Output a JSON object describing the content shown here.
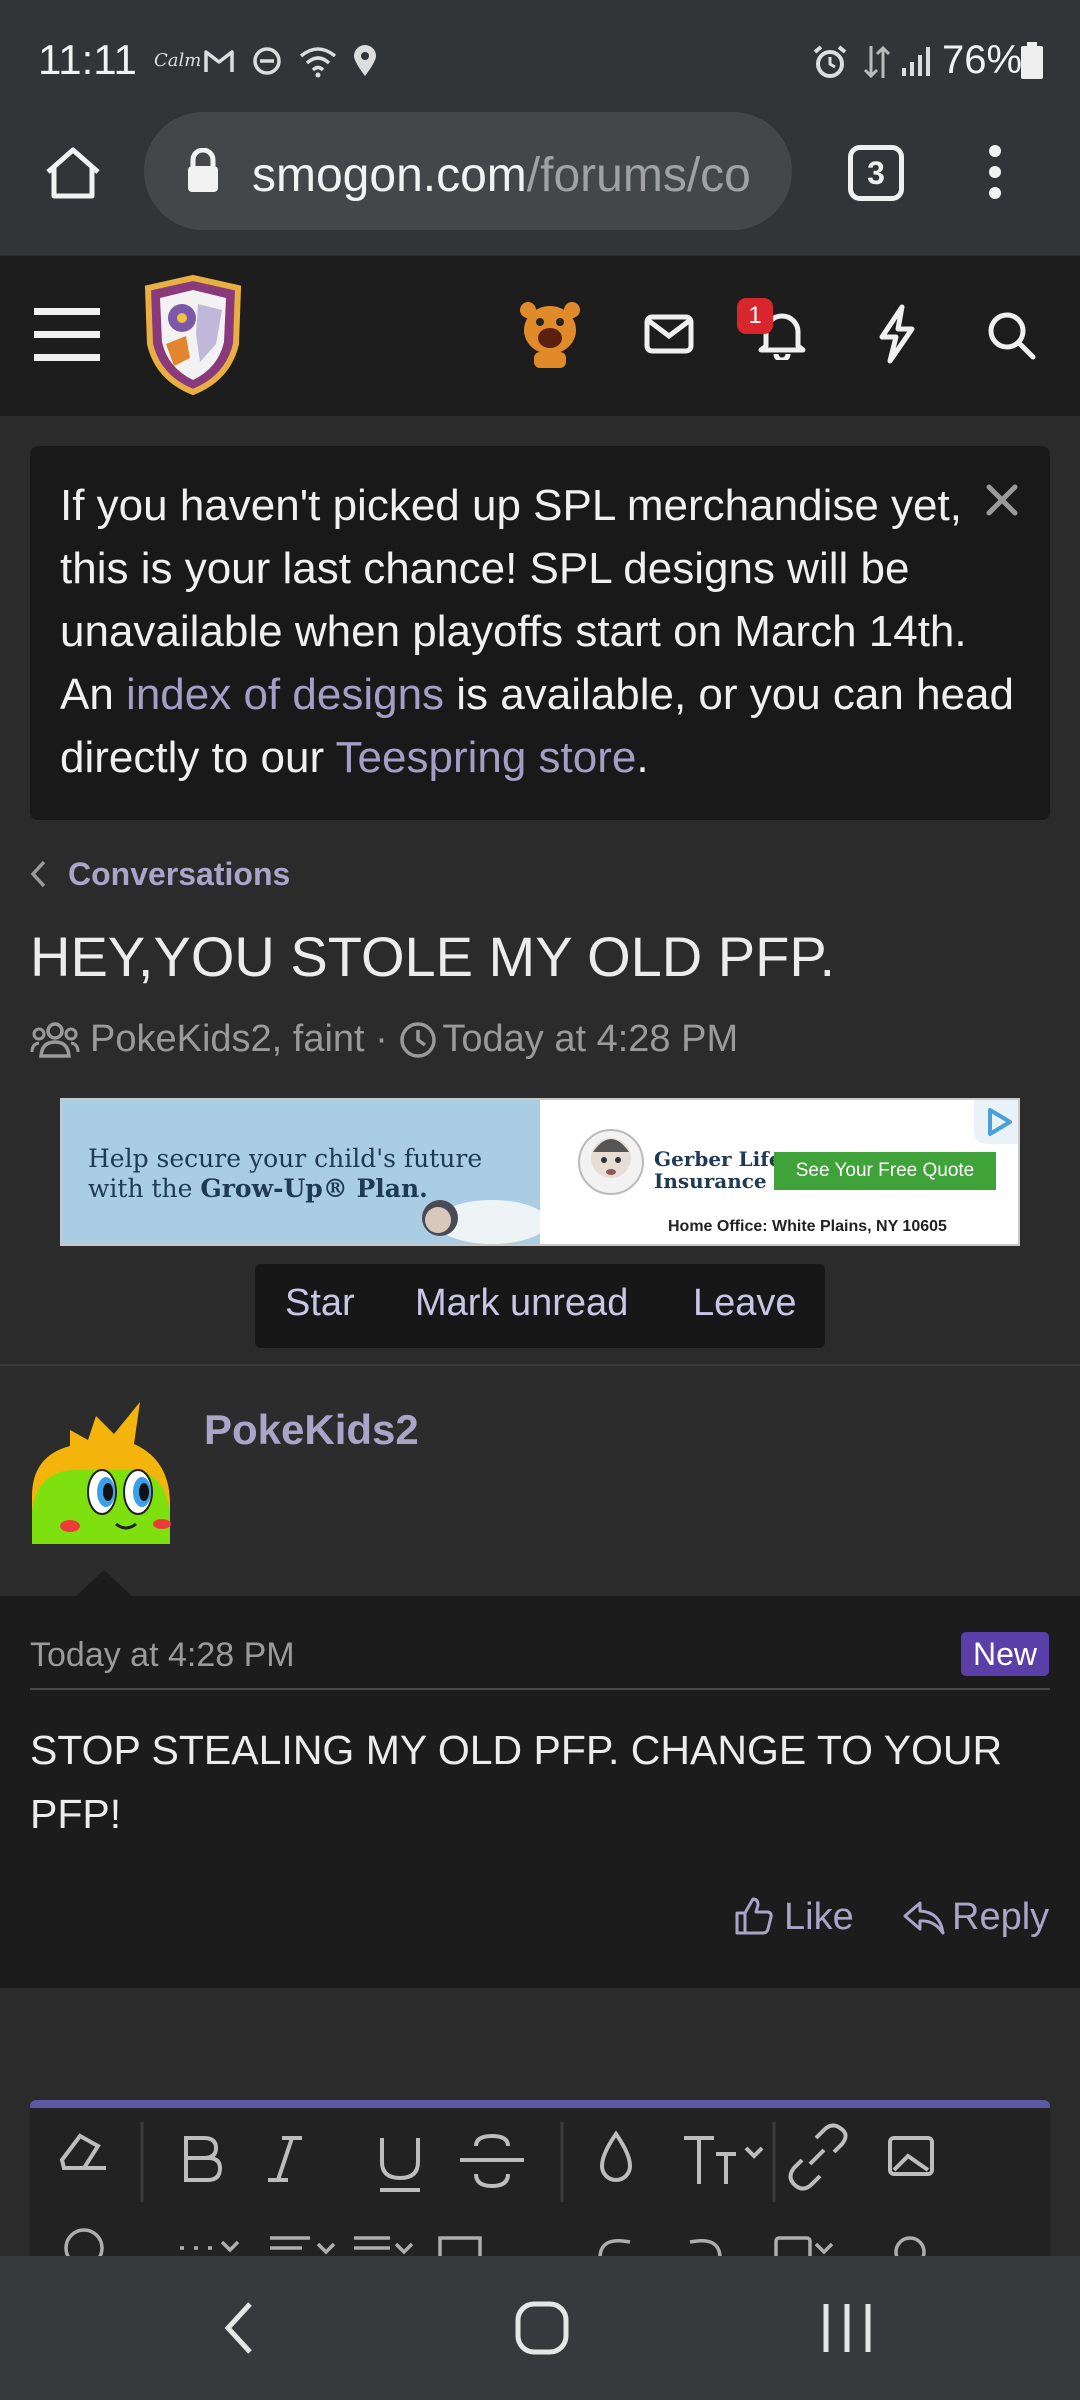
{
  "status_bar": {
    "time": "11:11",
    "calm_label": "Calm",
    "battery": "76%"
  },
  "browser": {
    "url_host": "smogon.com",
    "url_path": "/forums/co",
    "tab_count": "3"
  },
  "header": {
    "notification_count": "1"
  },
  "notice": {
    "text_1": "If you haven't picked up SPL merchandise yet, this is your last chance! SPL designs will be unavailable when playoffs start on March 14th. An ",
    "link_1": "index of designs",
    "text_2": " is available, or you can head directly to our ",
    "link_2": "Teespring store",
    "text_3": "."
  },
  "breadcrumb": "Conversations",
  "conversation": {
    "title": "HEY,YOU STOLE MY OLD PFP.",
    "participants": "PokeKids2, faint",
    "separator": "·",
    "time": "Today at 4:28 PM"
  },
  "ad": {
    "copy_line1": "Help secure your child's future",
    "copy_line2_prefix": "with the ",
    "copy_line2_bold": "Grow-Up® Plan.",
    "brand_line1": "Gerber Life",
    "brand_line2": "Insurance",
    "cta": "See Your Free Quote",
    "office": "Home Office: White Plains, NY 10605"
  },
  "actions": {
    "star": "Star",
    "mark_unread": "Mark unread",
    "leave": "Leave"
  },
  "message": {
    "author": "PokeKids2",
    "date": "Today at 4:28 PM",
    "new_badge": "New",
    "body": "STOP STEALING MY OLD PFP. CHANGE TO YOUR PFP!",
    "like": "Like",
    "reply": "Reply"
  },
  "colors": {
    "accent": "#a9a4c8",
    "new_badge": "#5b3fa8",
    "notification": "#d9262c",
    "editor_border": "#5b59a6"
  }
}
